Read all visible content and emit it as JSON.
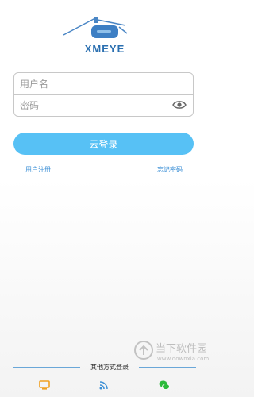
{
  "logo": {
    "text": "XMEYE"
  },
  "form": {
    "username_placeholder": "用户名",
    "password_placeholder": "密码"
  },
  "buttons": {
    "login_label": "云登录"
  },
  "links": {
    "register": "用户注册",
    "forgot": "忘记密码"
  },
  "other_login": {
    "label": "其他方式登录",
    "icons": [
      "local-device-icon",
      "ap-wifi-icon",
      "wechat-icon"
    ]
  },
  "watermark": {
    "text": "当下软件园",
    "url": "www.downxia.com"
  },
  "colors": {
    "accent": "#57c1f5",
    "link": "#3b8fd6",
    "logo": "#2a6fb0"
  }
}
